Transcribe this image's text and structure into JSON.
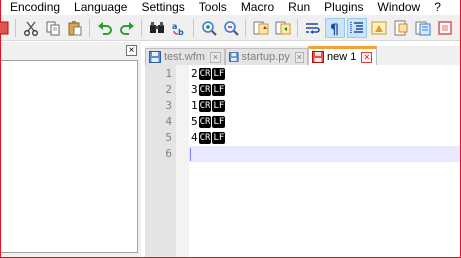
{
  "menu": {
    "items": [
      "Encoding",
      "Language",
      "Settings",
      "Tools",
      "Macro",
      "Run",
      "Plugins",
      "Window",
      "?"
    ]
  },
  "toolbar": {
    "buttons": [
      "partial-red-icon",
      "cut-icon",
      "copy-icon",
      "paste-icon",
      "undo-icon",
      "redo-icon",
      "find-icon",
      "replace-icon",
      "zoom-in-icon",
      "zoom-out-icon",
      "sync-vertical-icon",
      "sync-horizontal-icon",
      "word-wrap-icon",
      "show-all-characters-icon",
      "indent-guide-icon",
      "user-defined-language-icon",
      "document-map-icon",
      "partial-edge-icon"
    ]
  },
  "left_panel": {
    "close_label": "×"
  },
  "tabs": [
    {
      "label": "test.wfm",
      "active": false
    },
    {
      "label": "startup.py",
      "active": false
    },
    {
      "label": "new 1",
      "active": true
    }
  ],
  "tab_close_label": "×",
  "editor": {
    "line_numbers": [
      "1",
      "2",
      "3",
      "4",
      "5",
      "6"
    ],
    "lines": [
      {
        "text": "2",
        "eol_cr": "CR",
        "eol_lf": "LF"
      },
      {
        "text": "3",
        "eol_cr": "CR",
        "eol_lf": "LF"
      },
      {
        "text": "1",
        "eol_cr": "CR",
        "eol_lf": "LF"
      },
      {
        "text": "5",
        "eol_cr": "CR",
        "eol_lf": "LF"
      },
      {
        "text": "4",
        "eol_cr": "CR",
        "eol_lf": "LF"
      },
      {
        "text": "",
        "eol_cr": null,
        "eol_lf": null
      }
    ],
    "current_line": 6
  },
  "colors": {
    "frame": "#e81123",
    "active_tab_accent": "#f3a23b",
    "current_line": "#e8e8ff",
    "gutter": "#e4e4e4"
  }
}
